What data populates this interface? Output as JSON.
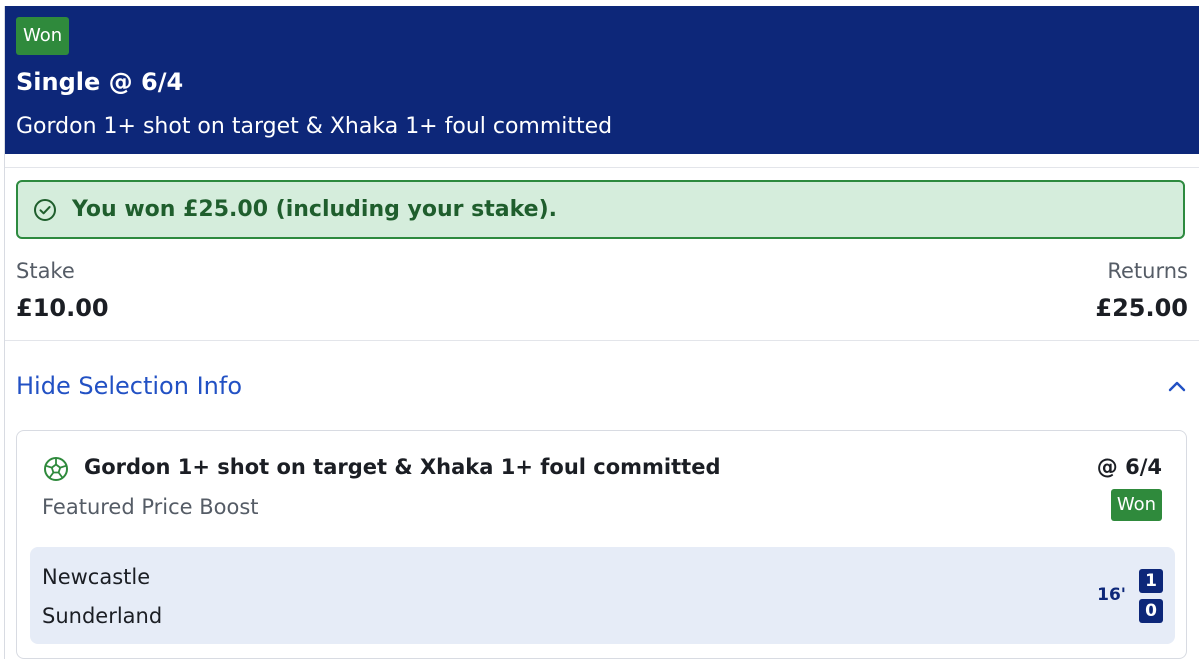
{
  "bet": {
    "status": "Won",
    "title": "Single @ 6/4",
    "description": "Gordon 1+ shot on target & Xhaka 1+ foul committed"
  },
  "win_banner": {
    "message": "You won £25.00 (including your stake).",
    "icon": "check-circle-icon"
  },
  "stake": {
    "label": "Stake",
    "value": "£10.00"
  },
  "returns": {
    "label": "Returns",
    "value": "£25.00"
  },
  "selection_toggle": {
    "label": "Hide Selection Info",
    "icon": "chevron-up-icon"
  },
  "selection": {
    "icon": "football-icon",
    "title": "Gordon 1+ shot on target & Xhaka 1+ foul committed",
    "odds": "@ 6/4",
    "market": "Featured Price Boost",
    "status": "Won"
  },
  "match": {
    "home_team": "Newcastle",
    "away_team": "Sunderland",
    "clock": "16'",
    "home_score": "1",
    "away_score": "0"
  },
  "colors": {
    "header_bg": "#0d2779",
    "won_green": "#2f8a3c",
    "banner_bg": "#d5eddc",
    "link_blue": "#2251c4",
    "scoreboard_bg": "#e6ecf7"
  }
}
